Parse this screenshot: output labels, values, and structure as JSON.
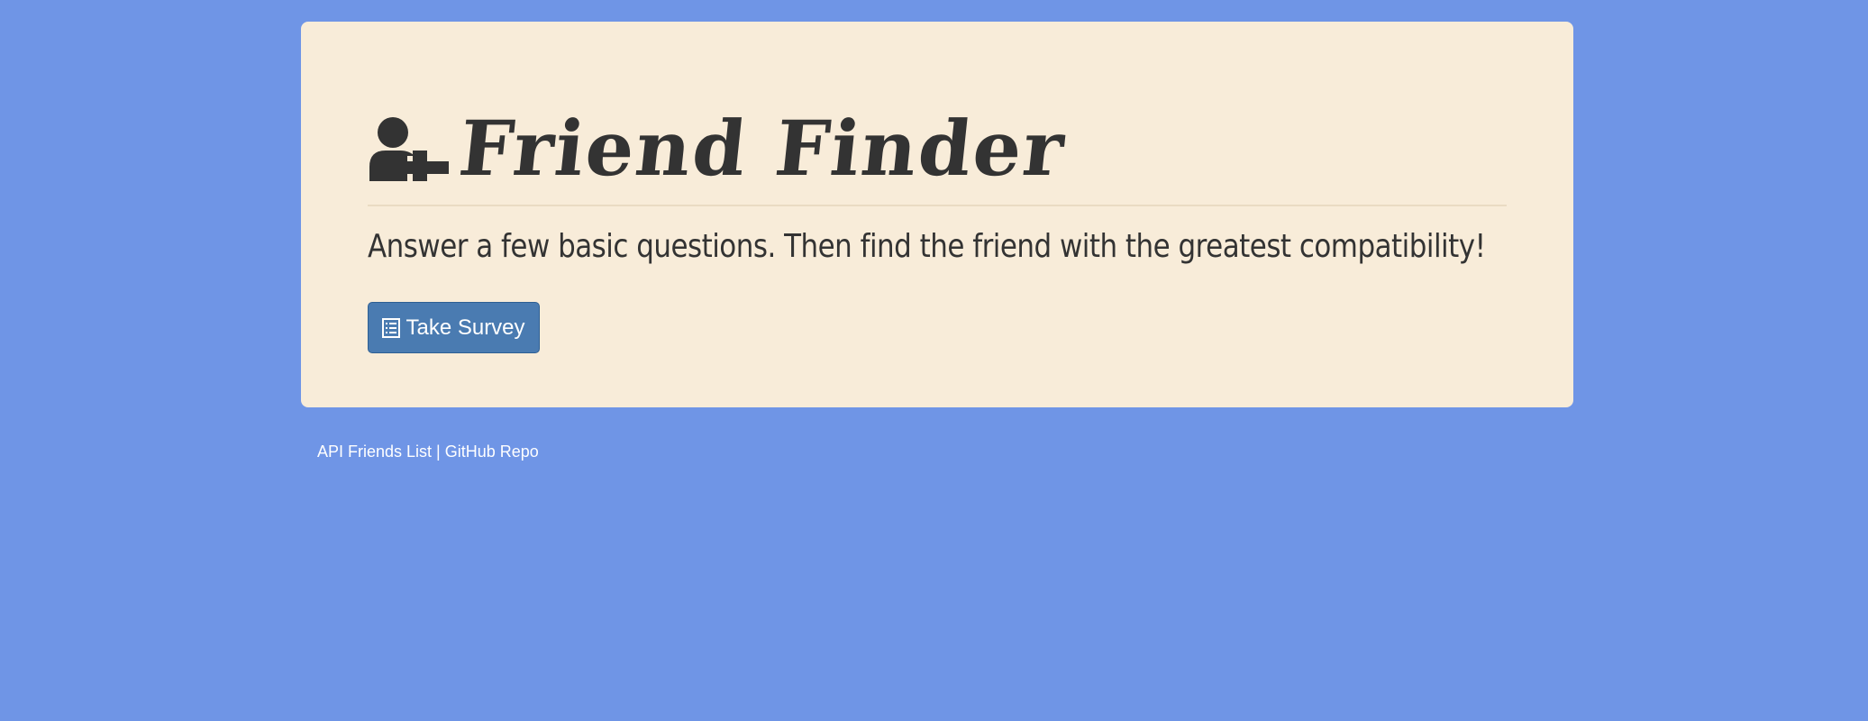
{
  "header": {
    "icon": "user-plus-icon",
    "title": "Friend Finder"
  },
  "main": {
    "tagline": "Answer a few basic questions. Then find the friend with the greatest compatibility!",
    "survey_button": {
      "icon": "list-alt-icon",
      "label": "Take Survey"
    }
  },
  "footer": {
    "links": [
      {
        "label": "API Friends List"
      },
      {
        "label": "GitHub Repo"
      }
    ],
    "separator": "|"
  },
  "colors": {
    "page_background": "#6f95e6",
    "card_background": "#f8ecd9",
    "text_dark": "#333333",
    "button_primary": "#4a7bb1",
    "footer_text": "#ffffff"
  }
}
